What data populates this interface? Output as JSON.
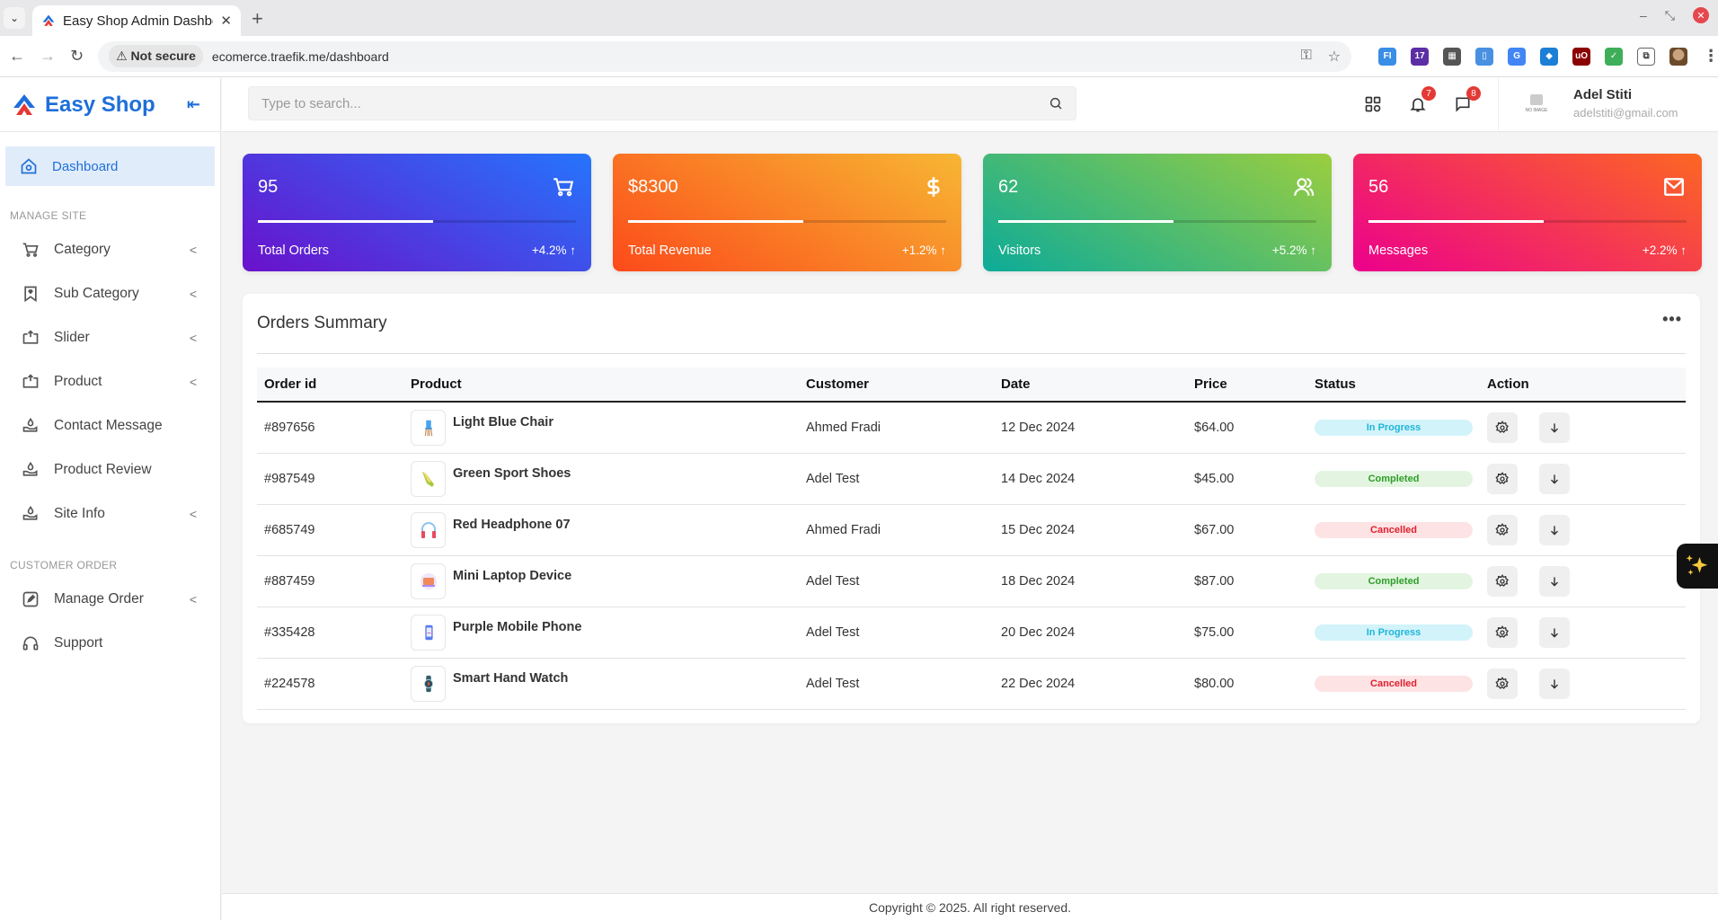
{
  "browser": {
    "tab_title": "Easy Shop Admin Dashboard",
    "security_label": "Not secure",
    "url": "ecomerce.traefik.me/dashboard",
    "extension_badge": "17"
  },
  "sidebar": {
    "brand": "Easy Shop",
    "active_item": {
      "label": "Dashboard",
      "icon": "home-icon"
    },
    "sections": [
      {
        "title": "MANAGE SITE",
        "items": [
          {
            "label": "Category",
            "icon": "cart-icon",
            "has_submenu": true
          },
          {
            "label": "Sub Category",
            "icon": "bookmark-heart-icon",
            "has_submenu": true
          },
          {
            "label": "Slider",
            "icon": "slider-icon",
            "has_submenu": true
          },
          {
            "label": "Product",
            "icon": "product-icon",
            "has_submenu": true
          },
          {
            "label": "Contact Message",
            "icon": "hand-drop-icon",
            "has_submenu": false
          },
          {
            "label": "Product Review",
            "icon": "hand-drop-icon",
            "has_submenu": false
          },
          {
            "label": "Site Info",
            "icon": "hand-drop-icon",
            "has_submenu": true
          }
        ]
      },
      {
        "title": "CUSTOMER ORDER",
        "items": [
          {
            "label": "Manage Order",
            "icon": "edit-icon",
            "has_submenu": true
          },
          {
            "label": "Support",
            "icon": "headset-icon",
            "has_submenu": false
          }
        ]
      }
    ]
  },
  "header": {
    "search_placeholder": "Type to search...",
    "notifications_count": "7",
    "messages_count": "8",
    "user": {
      "name": "Adel Stiti",
      "email": "adelstiti@gmail.com",
      "avatar_text": "NO IMAGE"
    }
  },
  "stats": [
    {
      "value": "95",
      "label": "Total Orders",
      "change": "+4.2%",
      "icon": "cart-icon",
      "progress": 0.55
    },
    {
      "value": "$8300",
      "label": "Total Revenue",
      "change": "+1.2%",
      "icon": "dollar-icon",
      "progress": 0.55
    },
    {
      "value": "62",
      "label": "Visitors",
      "change": "+5.2%",
      "icon": "users-icon",
      "progress": 0.55
    },
    {
      "value": "56",
      "label": "Messages",
      "change": "+2.2%",
      "icon": "mail-icon",
      "progress": 0.55
    }
  ],
  "orders": {
    "title": "Orders Summary",
    "columns": [
      "Order id",
      "Product",
      "Customer",
      "Date",
      "Price",
      "Status",
      "Action"
    ],
    "rows": [
      {
        "id": "#897656",
        "product": "Light Blue Chair",
        "thumb": "chair",
        "customer": "Ahmed Fradi",
        "date": "12 Dec 2024",
        "price": "$64.00",
        "status": "In Progress",
        "status_key": "progress"
      },
      {
        "id": "#987549",
        "product": "Green Sport Shoes",
        "thumb": "shoe",
        "customer": "Adel Test",
        "date": "14 Dec 2024",
        "price": "$45.00",
        "status": "Completed",
        "status_key": "completed"
      },
      {
        "id": "#685749",
        "product": "Red Headphone 07",
        "thumb": "headphone",
        "customer": "Ahmed Fradi",
        "date": "15 Dec 2024",
        "price": "$67.00",
        "status": "Cancelled",
        "status_key": "cancelled"
      },
      {
        "id": "#887459",
        "product": "Mini Laptop Device",
        "thumb": "laptop",
        "customer": "Adel Test",
        "date": "18 Dec 2024",
        "price": "$87.00",
        "status": "Completed",
        "status_key": "completed"
      },
      {
        "id": "#335428",
        "product": "Purple Mobile Phone",
        "thumb": "phone",
        "customer": "Adel Test",
        "date": "20 Dec 2024",
        "price": "$75.00",
        "status": "In Progress",
        "status_key": "progress"
      },
      {
        "id": "#224578",
        "product": "Smart Hand Watch",
        "thumb": "watch",
        "customer": "Adel Test",
        "date": "22 Dec 2024",
        "price": "$80.00",
        "status": "Cancelled",
        "status_key": "cancelled"
      }
    ]
  },
  "footer": {
    "text": "Copyright © 2025. All right reserved."
  },
  "colors": {
    "brand": "#1e6fd9",
    "badge": "#e53935"
  }
}
